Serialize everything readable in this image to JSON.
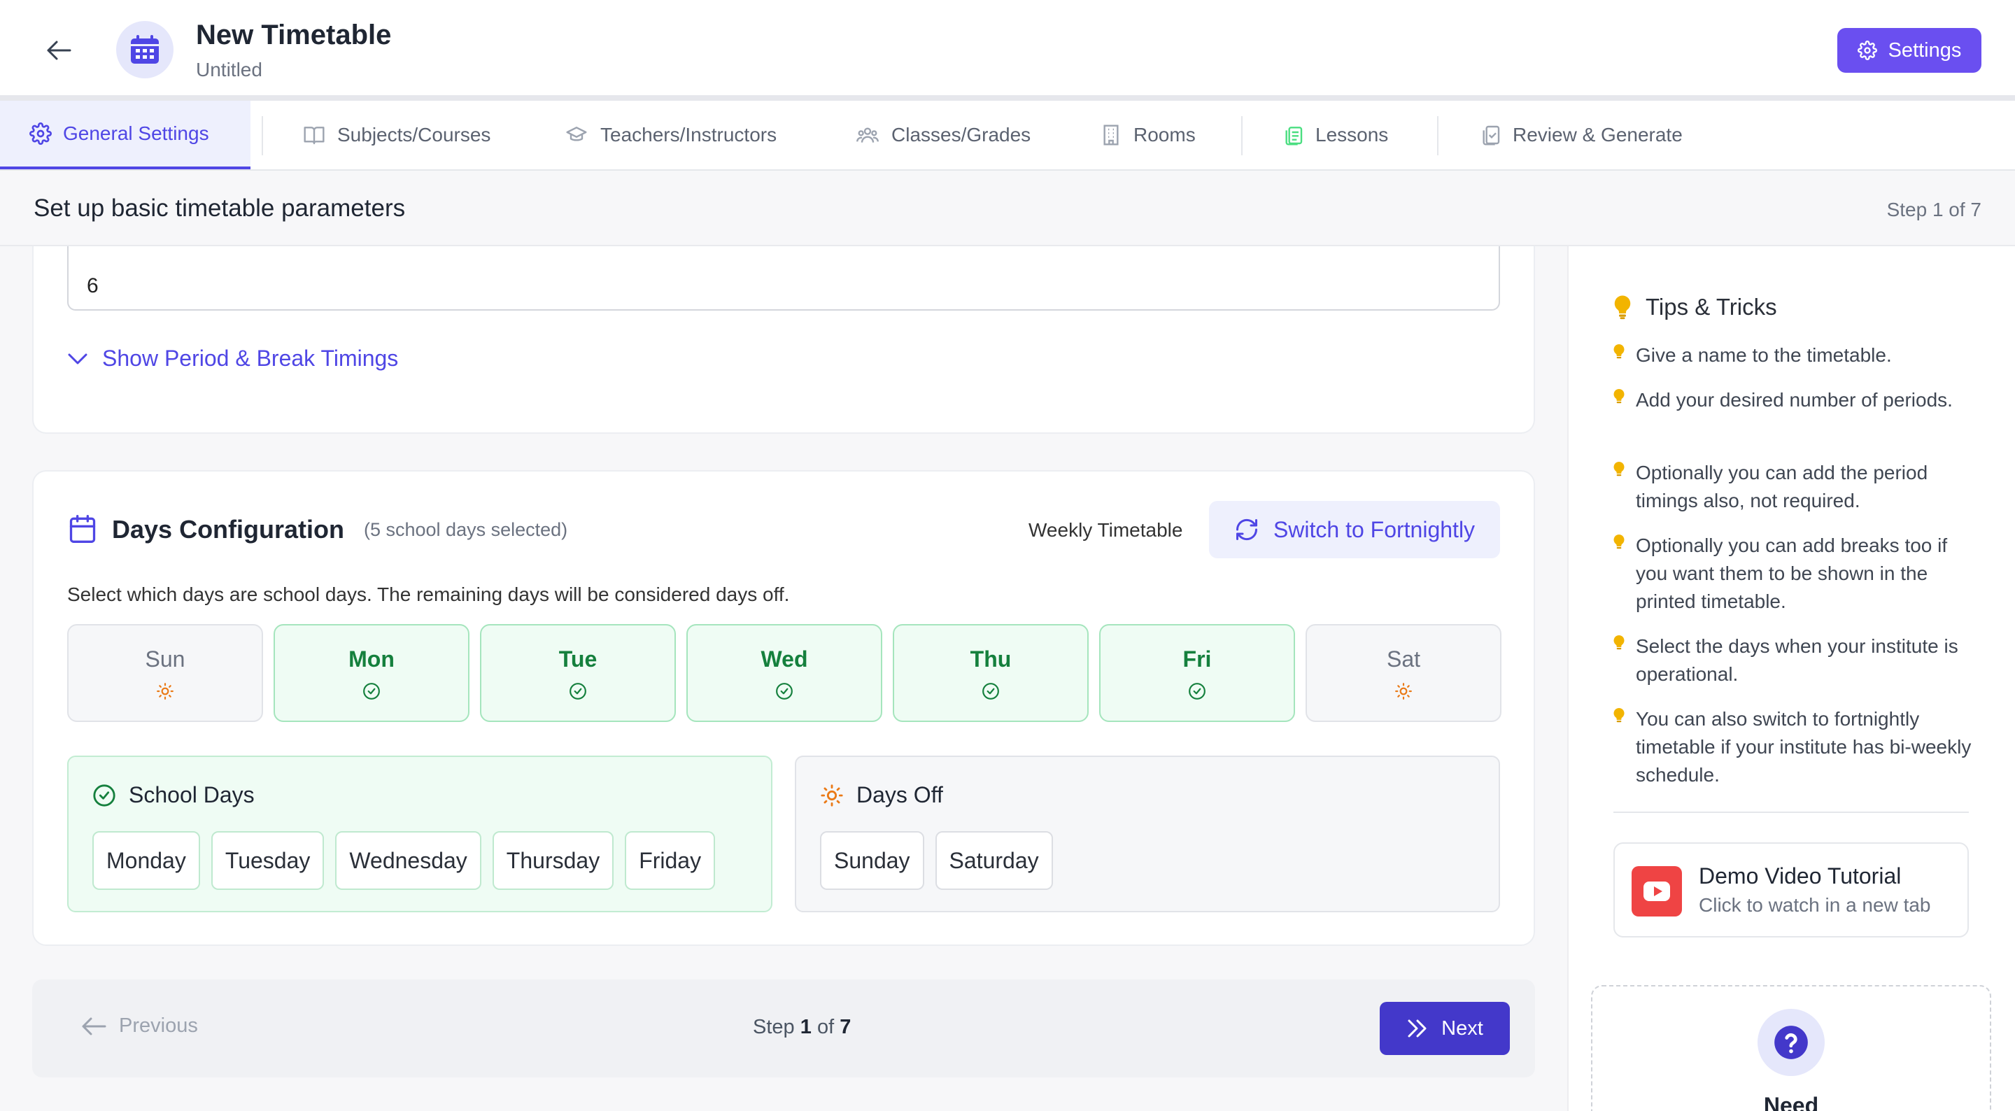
{
  "header": {
    "title": "New Timetable",
    "subtitle": "Untitled",
    "settings_label": "Settings",
    "icons": {
      "back": "arrow-left-icon",
      "app": "calendar-icon",
      "settings": "gear-icon"
    }
  },
  "tabs": [
    {
      "label": "General Settings",
      "icon": "gear-icon",
      "active": true
    },
    {
      "label": "Subjects/Courses",
      "icon": "book-icon"
    },
    {
      "label": "Teachers/Instructors",
      "icon": "graduation-cap-icon"
    },
    {
      "label": "Classes/Grades",
      "icon": "users-icon"
    },
    {
      "label": "Rooms",
      "icon": "building-icon"
    },
    {
      "label": "Lessons",
      "icon": "copy-document-icon"
    },
    {
      "label": "Review & Generate",
      "icon": "clipboard-check-icon"
    }
  ],
  "subheader": {
    "title": "Set up basic timetable parameters",
    "step": "Step 1 of 7"
  },
  "periods": {
    "value": "6",
    "show_timings_label": "Show Period & Break Timings"
  },
  "days_config": {
    "title": "Days Configuration",
    "count_text": "(5 school days selected)",
    "mode_label": "Weekly Timetable",
    "switch_label": "Switch to Fortnightly",
    "description": "Select which days are school days. The remaining days will be considered days off.",
    "days": [
      {
        "label": "Sun",
        "selected": false
      },
      {
        "label": "Mon",
        "selected": true
      },
      {
        "label": "Tue",
        "selected": true
      },
      {
        "label": "Wed",
        "selected": true
      },
      {
        "label": "Thu",
        "selected": true
      },
      {
        "label": "Fri",
        "selected": true
      },
      {
        "label": "Sat",
        "selected": false
      }
    ],
    "school_days": {
      "title": "School Days",
      "items": [
        "Monday",
        "Tuesday",
        "Wednesday",
        "Thursday",
        "Friday"
      ]
    },
    "days_off": {
      "title": "Days Off",
      "items": [
        "Sunday",
        "Saturday"
      ]
    }
  },
  "footer": {
    "previous_label": "Previous",
    "step_prefix": "Step",
    "step_current": "1",
    "step_of": "of",
    "step_total": "7",
    "next_label": "Next"
  },
  "sidebar": {
    "tips_title": "Tips & Tricks",
    "tips": [
      "Give a name to the timetable.",
      "Add your desired number of periods.",
      "Optionally you can add the period timings also, not required.",
      "Optionally you can add breaks too if you want them to be shown in the printed timetable.",
      "Select the days when your institute is operational.",
      "You can also switch to fortnightly timetable if your institute has bi-weekly schedule."
    ],
    "demo": {
      "title": "Demo Video Tutorial",
      "subtitle": "Click to watch in a new tab"
    },
    "help": {
      "title": "Need help?"
    }
  },
  "colors": {
    "accent": "#4f46e5",
    "brand": "#6a4ff0",
    "success": "#15803d",
    "warning": "#ea7a17",
    "danger": "#ef4444"
  }
}
